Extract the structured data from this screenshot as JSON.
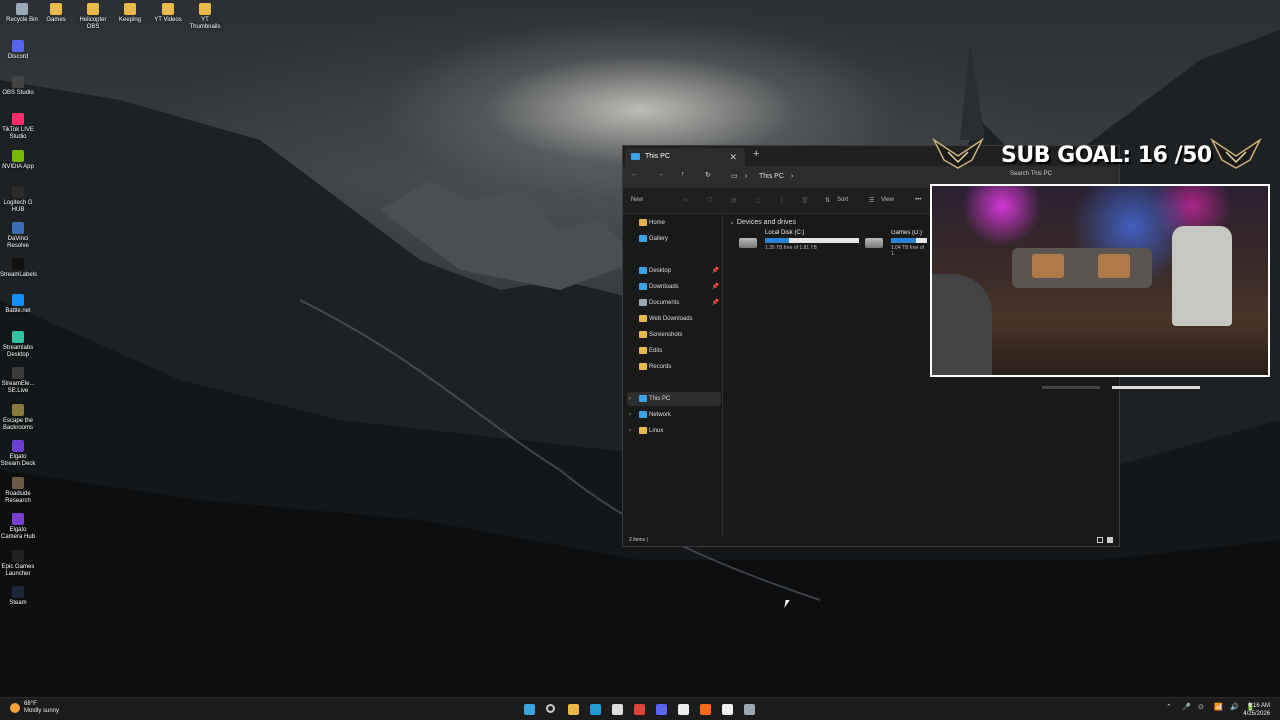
{
  "desktop_icons": [
    {
      "label": "Recycle Bin",
      "color": "#9aa7b5"
    },
    {
      "label": "Games",
      "color": "#e9b949"
    },
    {
      "label": "Helicopter OBS",
      "color": "#e9b949"
    },
    {
      "label": "Keeping",
      "color": "#e9b949"
    },
    {
      "label": "YT Videos",
      "color": "#e9b949"
    },
    {
      "label": "YT Thumbnails",
      "color": "#e9b949"
    },
    {
      "label": "Discord",
      "color": "#5865f2"
    },
    {
      "label": "OBS Studio",
      "color": "#444444"
    },
    {
      "label": "TikTok LIVE Studio",
      "color": "#ff2d6d"
    },
    {
      "label": "NVIDIA App",
      "color": "#76b900"
    },
    {
      "label": "Logitech G HUB",
      "color": "#2b2b2b"
    },
    {
      "label": "DaVinci Resolve",
      "color": "#3a6fb5"
    },
    {
      "label": "StreamLabels",
      "color": "#111111"
    },
    {
      "label": "Battle.net",
      "color": "#148eff"
    },
    {
      "label": "Streamlabs Desktop",
      "color": "#31c3a2"
    },
    {
      "label": "StreamEle... SE.Live",
      "color": "#3c3c3c"
    },
    {
      "label": "Escape the Backrooms",
      "color": "#8b7a3a"
    },
    {
      "label": "Elgato Stream Deck",
      "color": "#6a3fd1"
    },
    {
      "label": "Roadside Research",
      "color": "#6b5a45"
    },
    {
      "label": "Elgato Camera Hub",
      "color": "#7a3fd1"
    },
    {
      "label": "Epic Games Launcher",
      "color": "#222222"
    },
    {
      "label": "Steam",
      "color": "#1b2838"
    }
  ],
  "explorer": {
    "tab_title": "This PC",
    "close_glyph": "✕",
    "new_tab_glyph": "+",
    "breadcrumb": "This PC",
    "search_placeholder": "Search This PC",
    "cmd_new": "New",
    "cmd_sort": "Sort",
    "cmd_view": "View",
    "cmd_more": "•••",
    "nav_items": [
      {
        "label": "Home",
        "icon": "home-icon",
        "color": "#e8b04a"
      },
      {
        "label": "Gallery",
        "icon": "gallery-icon",
        "color": "#3aa3e3"
      },
      {
        "label": "Desktop",
        "icon": "desktop-icon",
        "color": "#3aa3e3",
        "pinned": true
      },
      {
        "label": "Downloads",
        "icon": "downloads-icon",
        "color": "#3aa3e3",
        "pinned": true
      },
      {
        "label": "Documents",
        "icon": "documents-icon",
        "color": "#9aa7b5",
        "pinned": true
      },
      {
        "label": "Web Downloads",
        "icon": "folder-icon",
        "color": "#e9b949"
      },
      {
        "label": "Screenshots",
        "icon": "folder-icon",
        "color": "#e9b949"
      },
      {
        "label": "Edits",
        "icon": "folder-icon",
        "color": "#e9b949"
      },
      {
        "label": "Records",
        "icon": "folder-icon",
        "color": "#e9b949"
      },
      {
        "label": "This PC",
        "icon": "computer-icon",
        "color": "#3aa3e3",
        "selected": true
      },
      {
        "label": "Network",
        "icon": "network-icon",
        "color": "#3aa3e3"
      },
      {
        "label": "Linux",
        "icon": "linux-icon",
        "color": "#e9b949"
      }
    ],
    "section_title": "Devices and drives",
    "drives": [
      {
        "name": "Local Disk (C:)",
        "free": "1.35 TB free of 1.81 TB",
        "used_fraction": 0.25
      },
      {
        "name": "Games (D:)",
        "free": "1.04 TB free of 1.",
        "used_fraction": 0.42
      }
    ],
    "status": "2 items  |"
  },
  "overlay": {
    "sub_goal": "SUB GOAL: 16 /50"
  },
  "taskbar": {
    "weather_temp": "68°F",
    "weather_desc": "Mostly sunny",
    "time": "6:16 AM",
    "date": "4/25/2026",
    "apps": [
      {
        "name": "start-icon",
        "color": "#3aa3e3"
      },
      {
        "name": "search-icon",
        "color": "#cccccc"
      },
      {
        "name": "file-explorer-icon",
        "color": "#e9b949"
      },
      {
        "name": "edge-icon",
        "color": "#1f9cd8"
      },
      {
        "name": "store-icon",
        "color": "#dddddd"
      },
      {
        "name": "chrome-icon",
        "color": "#db4437"
      },
      {
        "name": "discord-icon",
        "color": "#5865f2"
      },
      {
        "name": "capcut-icon",
        "color": "#eeeeee"
      },
      {
        "name": "fl-studio-icon",
        "color": "#ff6a1a"
      },
      {
        "name": "streamlabels-icon",
        "color": "#f0f0f0"
      },
      {
        "name": "settings-icon",
        "color": "#9aa7b5"
      }
    ],
    "tray_glyphs": [
      "⌃",
      "🎤",
      "⊙",
      "📶",
      "🔊",
      "🔋"
    ]
  }
}
